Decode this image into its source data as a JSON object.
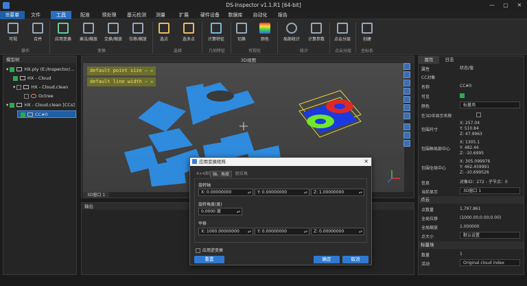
{
  "window": {
    "title": "DS-Inspector v1.1.R1 [64-bit]"
  },
  "menu": {
    "home": "☰菜单",
    "items": [
      "文件",
      "工具",
      "配准",
      "预处理",
      "基元检测",
      "测量",
      "扩展",
      "硬件设备",
      "数据库",
      "自动化",
      "报告"
    ],
    "active_index": 1
  },
  "ribbon": {
    "buttons": [
      "可视",
      "合并",
      "应用变换",
      "乘法/缩放",
      "交换/缩放",
      "位移/缩放",
      "选点",
      "选多点",
      "计算特征",
      "切换",
      "颜色",
      "局部统计",
      "计算参数",
      "点云分层",
      "创建"
    ],
    "groups": [
      "操作",
      "变换",
      "选择",
      "几何特征",
      "可视化",
      "统计",
      "点云分层",
      "坐标系"
    ]
  },
  "left_panel": {
    "title": "模型树",
    "items": [
      "HX.ply (E:/Inspector/...",
      "HX - Cloud",
      "HX - Cloud.clean",
      "Octree",
      "HX - Cloud.clean [CCs]",
      "CC#0"
    ]
  },
  "viewport": {
    "title": "3D视图",
    "point_size_label": "default point size",
    "line_width_label": "default line width",
    "tab": "3D窗口 1"
  },
  "output": {
    "title": "输出"
  },
  "right_panel": {
    "tabs": [
      "属性",
      "日志"
    ],
    "header_key": "属性",
    "header_val": "状态/值",
    "sec_object": "CC对象",
    "name_k": "名称",
    "name_v": "CC#0",
    "visible_k": "可见",
    "color_k": "颜色",
    "color_v": "标量场",
    "show_name_k": "在3D中显示名称",
    "bbox_size_k": "包围尺寸",
    "bbox_size_v": "X: 257.04\nY: 510.84\nZ: 47.9963",
    "bbox_center_k": "包围框局部中心",
    "bbox_center_v": "X: 1305.1\nY: 482.46\nZ: -10.6995",
    "global_center_k": "包围全局中心",
    "global_center_v": "X: 305.099976\nY: 462.459991\nZ: -10.699526",
    "info_k": "信息",
    "info_v": "对象ID：272 - 子节点：0",
    "display_k": "当前显示",
    "display_v": "3D窗口 1",
    "sec_cloud": "点云",
    "points_k": "点数量",
    "points_v": "1,797,861",
    "shift_k": "全局位移",
    "shift_v": "(1000.00;0.00;0.00)",
    "scale_k": "全局缩放",
    "scale_v": "1.000000",
    "psize_k": "点大小",
    "psize_v": "默认设置",
    "sec_sf": "标量场",
    "count_k": "数量",
    "count_v": "1",
    "active_k": "活动",
    "active_v": "Original cloud index"
  },
  "dialog": {
    "title": "应用变换矩阵",
    "tabs": [
      "4×4矩阵",
      "轴、角度",
      "欧拉角"
    ],
    "active_tab": 1,
    "axis_label": "旋转轴",
    "axis": [
      "X: 0.00000000",
      "Y: 0.00000000",
      "Z: 1.00000000"
    ],
    "angle_label": "旋转角度(度)",
    "angle": "0.0000 度",
    "translate_label": "平移",
    "translate": [
      "X: 1000.00000000",
      "Y: 0.00000000",
      "Z: 0.00000000"
    ],
    "inverse_label": "应用逆变换",
    "reset": "重置",
    "ok": "确定",
    "cancel": "取消"
  }
}
